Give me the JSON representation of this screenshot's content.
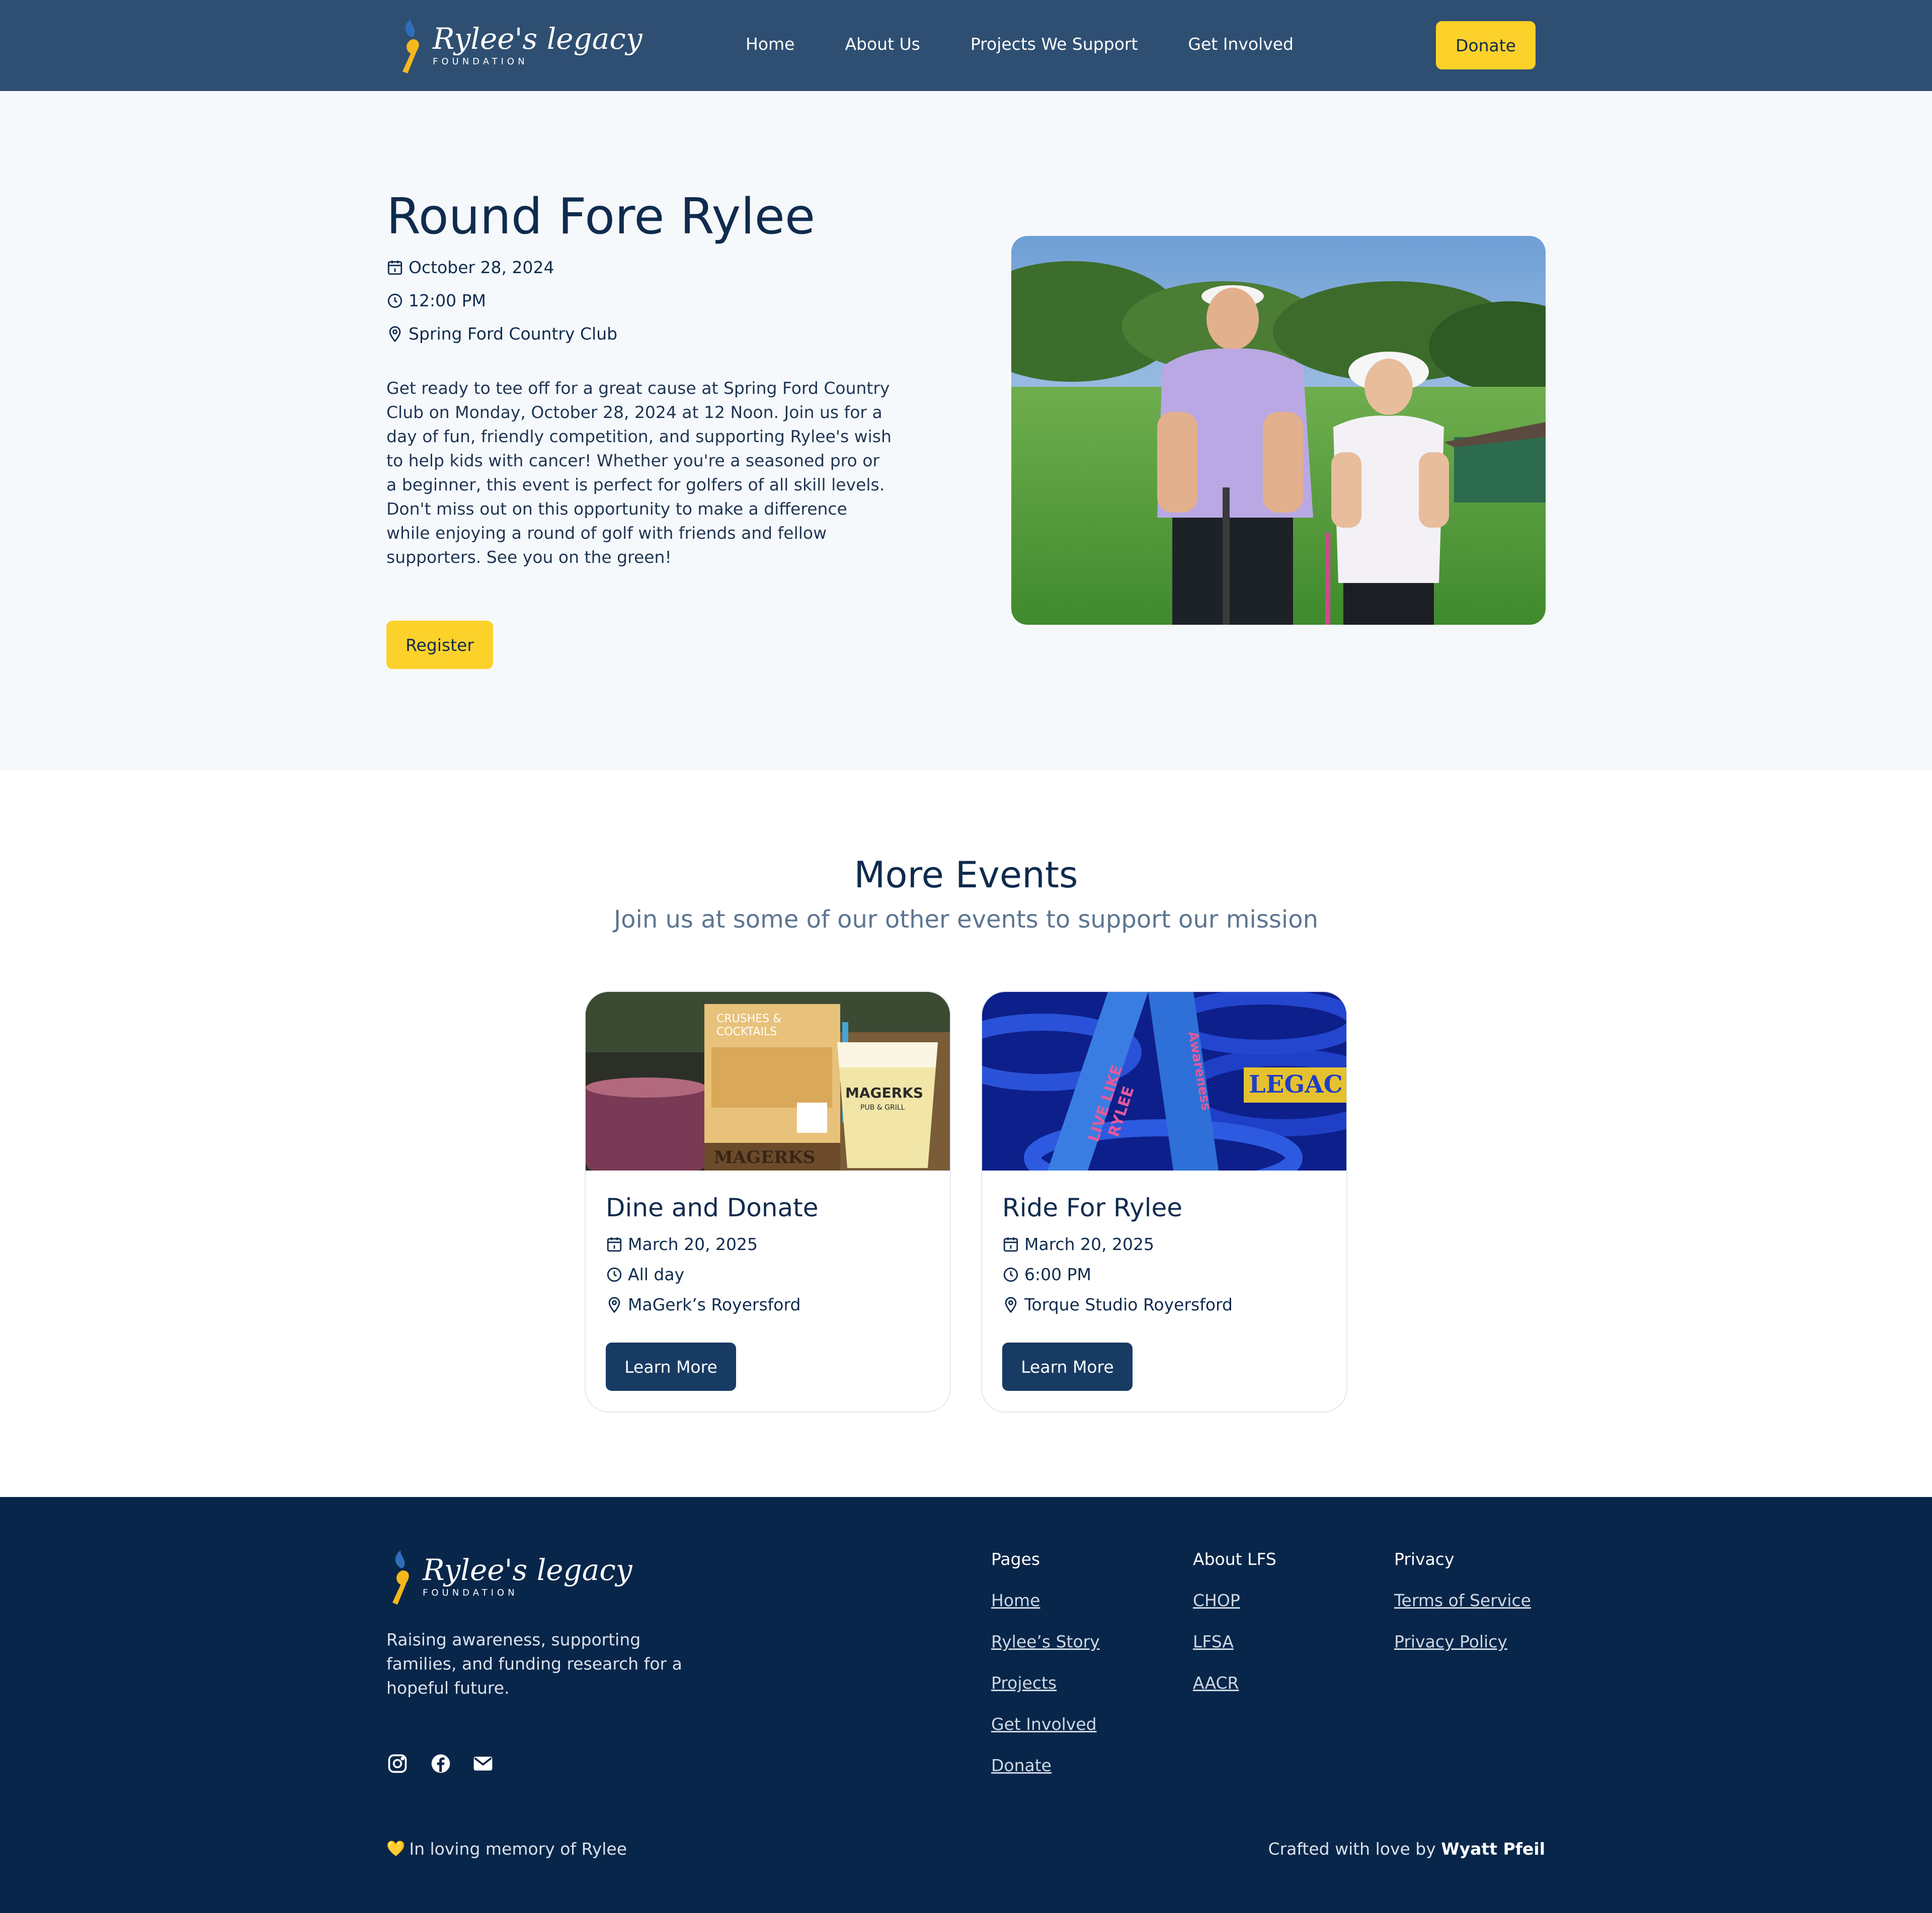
{
  "header": {
    "logo_script": "Rylee's legacy",
    "logo_sub": "FOUNDATION",
    "nav": [
      "Home",
      "About Us",
      "Projects We Support",
      "Get Involved"
    ],
    "donate_label": "Donate"
  },
  "hero": {
    "title": "Round Fore Rylee",
    "date": "October 28, 2024",
    "time": "12:00 PM",
    "location": "Spring Ford Country Club",
    "description": "Get ready to tee off for a great cause at Spring Ford Country Club on Monday, October 28, 2024 at 12 Noon. Join us for a day of fun, friendly competition, and supporting Rylee's wish to help kids with cancer! Whether you're a seasoned pro or a beginner, this event is perfect for golfers of all skill levels. Don't miss out on this opportunity to make a difference while enjoying a round of golf with friends and fellow supporters. See you on the green!",
    "register_label": "Register"
  },
  "more_events": {
    "title": "More Events",
    "subtitle": "Join us at some of our other events to support our mission",
    "cards": [
      {
        "title": "Dine and Donate",
        "date": "March 20, 2025",
        "time": "All day",
        "location": "MaGerk’s Royersford",
        "button": "Learn More",
        "img_words": [
          "CRUSHES &",
          "COCKTAILS",
          "MAGERKS",
          "PUB & GRILL",
          "MAGERKS"
        ]
      },
      {
        "title": "Ride For Rylee",
        "date": "March 20, 2025",
        "time": "6:00 PM",
        "location": "Torque Studio Royersford",
        "button": "Learn More",
        "img_words": [
          "LIVE LIKE",
          "RYLEE",
          "Awareness",
          "LEGAC"
        ]
      }
    ]
  },
  "footer": {
    "logo_script": "Rylee's legacy",
    "logo_sub": "FOUNDATION",
    "tagline": "Raising awareness, supporting families, and funding research for a hopeful future.",
    "columns": [
      {
        "heading": "Pages",
        "links": [
          "Home",
          "Rylee’s Story",
          "Projects",
          "Get Involved",
          "Donate"
        ]
      },
      {
        "heading": "About LFS",
        "links": [
          "CHOP",
          "LFSA",
          "AACR"
        ]
      },
      {
        "heading": "Privacy",
        "links": [
          "Terms of Service",
          "Privacy Policy"
        ]
      }
    ],
    "memory": "In loving memory of Rylee",
    "memory_heart": "💛",
    "credit_prefix": "Crafted with love by",
    "credit_name": "Wyatt Pfeil"
  },
  "colors": {
    "header_bg": "#2f4f72",
    "accent_yellow": "#fcd12a",
    "navy": "#0f2b4e",
    "footer_bg": "#08264a"
  }
}
